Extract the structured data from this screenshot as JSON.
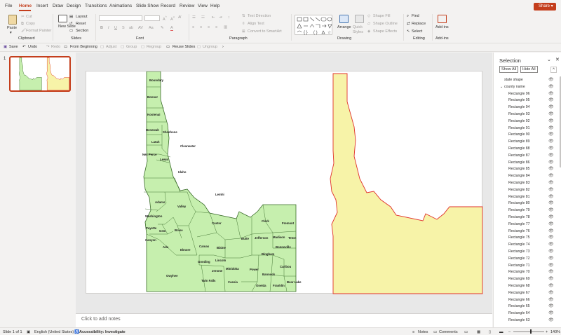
{
  "menu": {
    "items": [
      "File",
      "Home",
      "Insert",
      "Draw",
      "Design",
      "Transitions",
      "Animations",
      "Slide Show",
      "Record",
      "Review",
      "View",
      "Help"
    ],
    "active": "Home",
    "share_label": "Share"
  },
  "ribbon": {
    "clipboard": {
      "paste": "Paste",
      "cut": "Cut",
      "copy": "Copy",
      "format_painter": "Format Painter",
      "label": "Clipboard"
    },
    "slides": {
      "new_slide": "New Slide",
      "layout": "Layout",
      "reset": "Reset",
      "section": "Section",
      "label": "Slides"
    },
    "font": {
      "label": "Font"
    },
    "paragraph": {
      "text_direction": "Text Direction",
      "align_text": "Align Text",
      "convert_smartart": "Convert to SmartArt",
      "label": "Paragraph"
    },
    "drawing": {
      "arrange": "Arrange",
      "quick_styles": "Quick Styles",
      "shape_fill": "Shape Fill",
      "shape_outline": "Shape Outline",
      "shape_effects": "Shape Effects",
      "label": "Drawing"
    },
    "editing": {
      "find": "Find",
      "replace": "Replace",
      "select": "Select",
      "label": "Editing"
    },
    "addins": {
      "addins": "Add-ins",
      "label": "Add-ins"
    }
  },
  "qat": {
    "save": "Save",
    "undo": "Undo",
    "redo": "Redo",
    "from_beginning": "From Beginning",
    "adjust": "Adjust",
    "group": "Group",
    "regroup": "Regroup",
    "reuse_slides": "Reuse Slides",
    "ungroup": "Ungroup"
  },
  "thumbnail": {
    "number": "1"
  },
  "notes_placeholder": "Click to add notes",
  "selection_pane": {
    "title": "Selection",
    "show_all": "Show All",
    "hide_all": "Hide All",
    "items": [
      {
        "label": "state shape",
        "level": 0
      },
      {
        "label": "county name",
        "level": 0,
        "expanded": true
      },
      {
        "label": "Rectangle 96",
        "level": 1
      },
      {
        "label": "Rectangle 95",
        "level": 1
      },
      {
        "label": "Rectangle 94",
        "level": 1
      },
      {
        "label": "Rectangle 93",
        "level": 1
      },
      {
        "label": "Rectangle 92",
        "level": 1
      },
      {
        "label": "Rectangle 91",
        "level": 1
      },
      {
        "label": "Rectangle 90",
        "level": 1
      },
      {
        "label": "Rectangle 89",
        "level": 1
      },
      {
        "label": "Rectangle 88",
        "level": 1
      },
      {
        "label": "Rectangle 87",
        "level": 1
      },
      {
        "label": "Rectangle 86",
        "level": 1
      },
      {
        "label": "Rectangle 85",
        "level": 1
      },
      {
        "label": "Rectangle 84",
        "level": 1
      },
      {
        "label": "Rectangle 83",
        "level": 1
      },
      {
        "label": "Rectangle 82",
        "level": 1
      },
      {
        "label": "Rectangle 81",
        "level": 1
      },
      {
        "label": "Rectangle 80",
        "level": 1
      },
      {
        "label": "Rectangle 79",
        "level": 1
      },
      {
        "label": "Rectangle 78",
        "level": 1
      },
      {
        "label": "Rectangle 77",
        "level": 1
      },
      {
        "label": "Rectangle 76",
        "level": 1
      },
      {
        "label": "Rectangle 75",
        "level": 1
      },
      {
        "label": "Rectangle 74",
        "level": 1
      },
      {
        "label": "Rectangle 73",
        "level": 1
      },
      {
        "label": "Rectangle 72",
        "level": 1
      },
      {
        "label": "Rectangle 71",
        "level": 1
      },
      {
        "label": "Rectangle 70",
        "level": 1
      },
      {
        "label": "Rectangle 69",
        "level": 1
      },
      {
        "label": "Rectangle 68",
        "level": 1
      },
      {
        "label": "Rectangle 67",
        "level": 1
      },
      {
        "label": "Rectangle 66",
        "level": 1
      },
      {
        "label": "Rectangle 65",
        "level": 1
      },
      {
        "label": "Rectangle 64",
        "level": 1
      },
      {
        "label": "Rectangle 63",
        "level": 1
      }
    ]
  },
  "counties": [
    "Boundary",
    "Bonner",
    "Kootenai",
    "Benewah",
    "Shoshone",
    "Latah",
    "Clearwater",
    "Nez Perce",
    "Lewis",
    "Idaho",
    "Lemhi",
    "Adams",
    "Valley",
    "Washington",
    "Payette",
    "Gem",
    "Boise",
    "Custer",
    "Clark",
    "Fremont",
    "Canyon",
    "Ada",
    "Elmore",
    "Camas",
    "Blaine",
    "Butte",
    "Jefferson",
    "Madison",
    "Teton",
    "Bonneville",
    "Bingham",
    "Gooding",
    "Lincoln",
    "Jerome",
    "Minidoka",
    "Power",
    "Caribou",
    "Owyhee",
    "Twin Falls",
    "Cassia",
    "Bannock",
    "Oneida",
    "Franklin",
    "Bear Lake"
  ],
  "colors": {
    "county_fill": "#c6efae",
    "county_stroke": "#3a6b2a",
    "state_fill": "#f7f3a8",
    "state_stroke": "#e0302a",
    "accent": "#c43e1c"
  },
  "status": {
    "slide": "Slide 1 of 1",
    "language": "English (United States)",
    "accessibility": "Accessibility: Investigate",
    "notes": "Notes",
    "comments": "Comments",
    "zoom": "140%"
  }
}
